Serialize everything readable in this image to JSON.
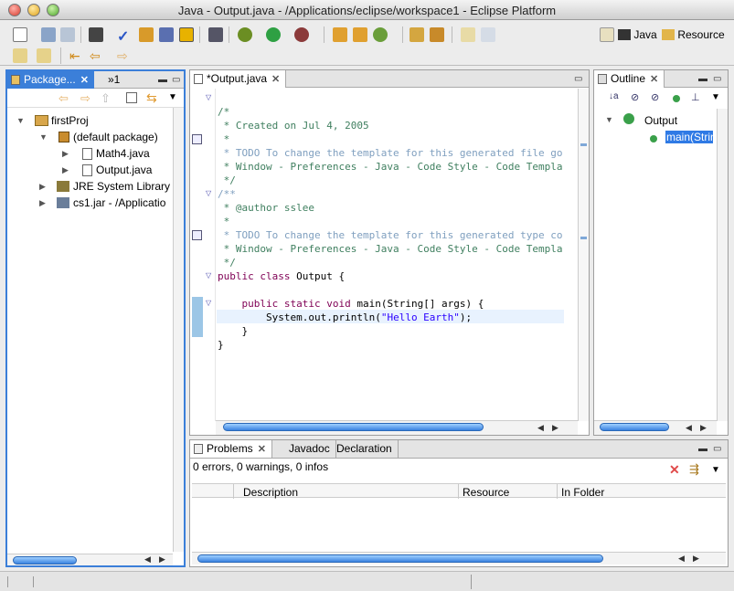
{
  "window": {
    "title": "Java - Output.java - /Applications/eclipse/workspace1 - Eclipse Platform"
  },
  "perspectives": [
    {
      "label": "Java"
    },
    {
      "label": "Resource"
    }
  ],
  "package_explorer": {
    "tab_label": "Package...",
    "tab2_label": "»1",
    "tree": [
      {
        "label": "firstProj"
      },
      {
        "label": "(default package)"
      },
      {
        "label": "Math4.java"
      },
      {
        "label": "Output.java"
      },
      {
        "label": "JRE System Library ["
      },
      {
        "label": "cs1.jar - /Applicatio"
      }
    ]
  },
  "editor": {
    "tab_label": "*Output.java",
    "lines": [
      {
        "text": "/*",
        "cls": "cm"
      },
      {
        "text": " * Created on Jul 4, 2005",
        "cls": "cm"
      },
      {
        "text": " *",
        "cls": "cm"
      },
      {
        "text": " * TODO To change the template for this generated file go",
        "cls": "cm"
      },
      {
        "text": " * Window - Preferences - Java - Code Style - Code Templa",
        "cls": "cm"
      },
      {
        "text": " */",
        "cls": "cm"
      },
      {
        "text": "",
        "cls": ""
      },
      {
        "text": "/**",
        "cls": "todo"
      },
      {
        "text": " * @author sslee",
        "cls": "cm"
      },
      {
        "text": " *",
        "cls": "cm"
      },
      {
        "text": " * TODO To change the template for this generated type co",
        "cls": "cm"
      },
      {
        "text": " * Window - Preferences - Java - Code Style - Code Templa",
        "cls": "cm"
      },
      {
        "text": " */",
        "cls": "cm"
      }
    ],
    "class_kw": "public class",
    "class_name": " Output {",
    "method_kw": "public static void",
    "method_rest": " main(String[] args) {",
    "print_prefix": "System.out.println(",
    "print_string": "\"Hello Earth\"",
    "print_suffix": ");",
    "close_inner": "}",
    "close_outer": "}"
  },
  "outline": {
    "tab_label": "Outline",
    "class_label": "Output",
    "method_label": "main(Strin"
  },
  "problems": {
    "tabs": [
      {
        "label": "Problems"
      },
      {
        "label": "Javadoc"
      },
      {
        "label": "Declaration"
      }
    ],
    "summary": "0 errors, 0 warnings, 0 infos",
    "columns": [
      {
        "label": "Description"
      },
      {
        "label": "Resource"
      },
      {
        "label": "In Folder"
      }
    ]
  },
  "colors": {
    "accent": "#3b7fd9",
    "selection": "#2f7ae5"
  }
}
